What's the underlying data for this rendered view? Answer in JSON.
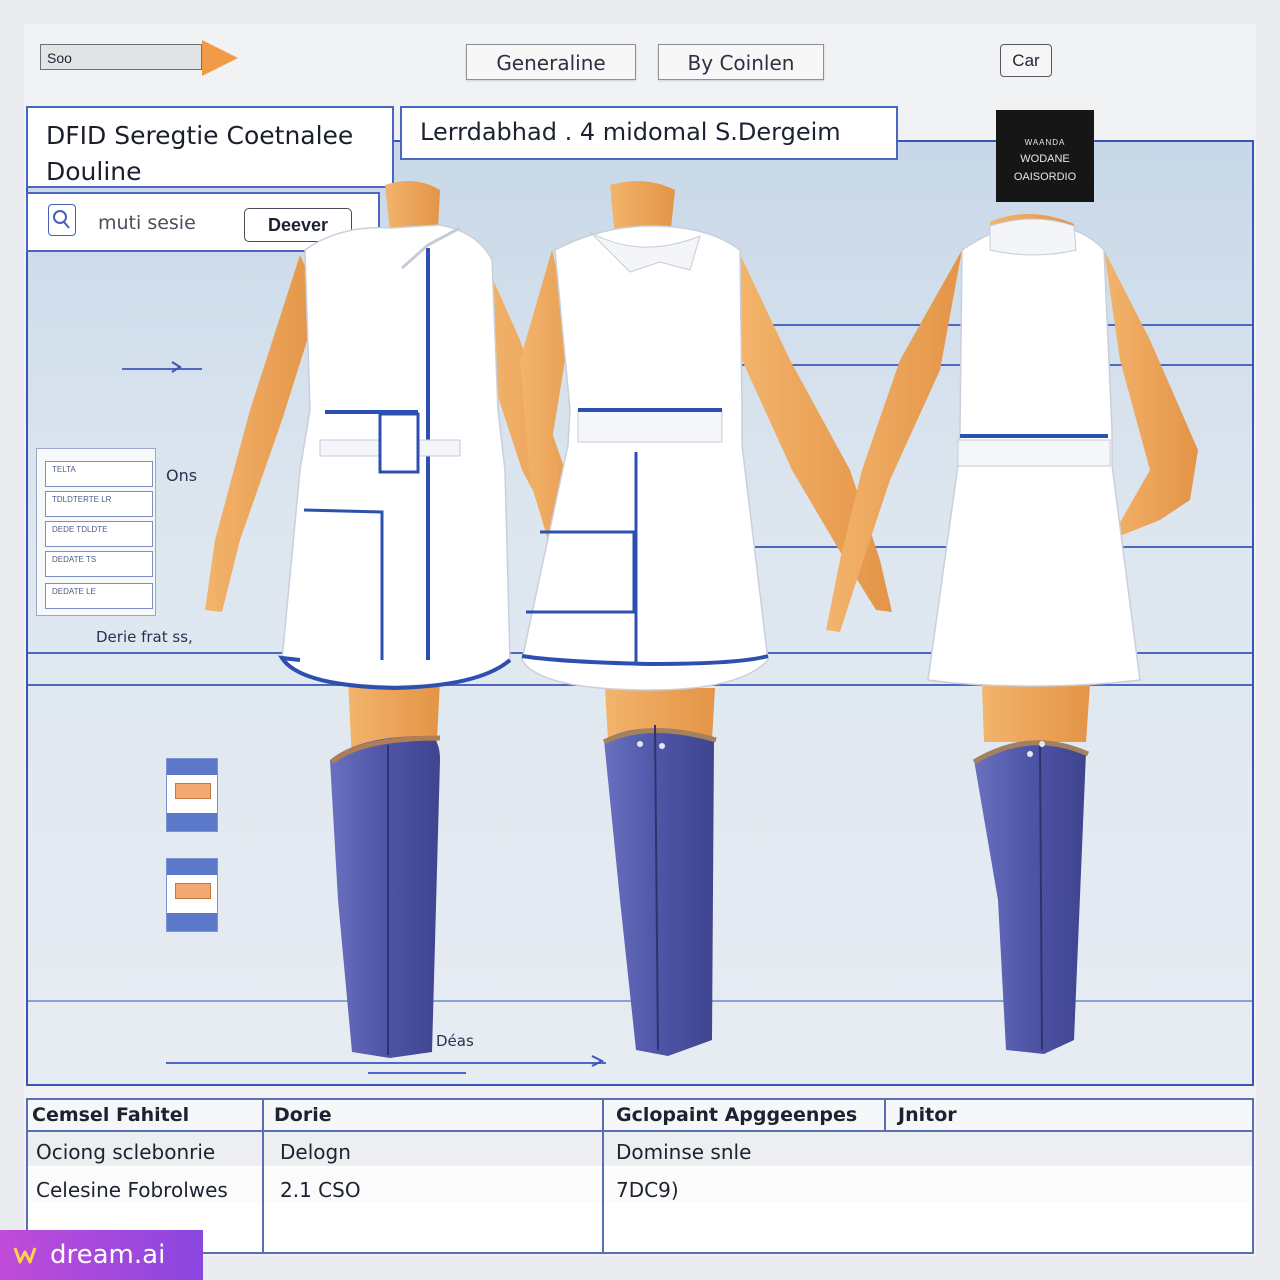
{
  "toolbar": {
    "search_value": "Soo",
    "button_1": "Generaline",
    "button_2": "By Coinlen",
    "small_button": "Car"
  },
  "header": {
    "title_line_1": "DFID Seregtie Coetnalee",
    "title_line_2": "Douline",
    "banner": "Lerrdabhad . 4 midomal S.Dergeim",
    "sub_label": "muti sesie",
    "deliver_button": "Deever"
  },
  "badge": {
    "line_1": "WAANDA",
    "line_2": "WODANE",
    "line_3": "OAISORDIO"
  },
  "annotations": {
    "left_label": "Ons",
    "left_bottom_label": "Derie frat ss,",
    "bottom_label": "Déas"
  },
  "side_list": {
    "items": [
      "TELTA",
      "TDLDTERTE LR",
      "DEDE TDLDTE",
      "DEDATE TS",
      "DEDATE LE"
    ]
  },
  "spec_table": {
    "headers": [
      "Cemsel Fahitel",
      "Dorie",
      "Gclopaint Apggeenpes",
      "Jnitor"
    ],
    "rows": [
      [
        "Ociong sclebonrie",
        "Delogn",
        "Dominse snle",
        ""
      ],
      [
        "Celesine Fobrolwes",
        "2.1 CSO",
        "7DC9)",
        ""
      ]
    ]
  },
  "colors": {
    "accent": "#3a56b5",
    "garment_trim": "#2d4fb0",
    "boots": "#5a5fae",
    "skin": "#f0a75c",
    "arrow": "#f19a48"
  },
  "watermark": "dream.ai"
}
